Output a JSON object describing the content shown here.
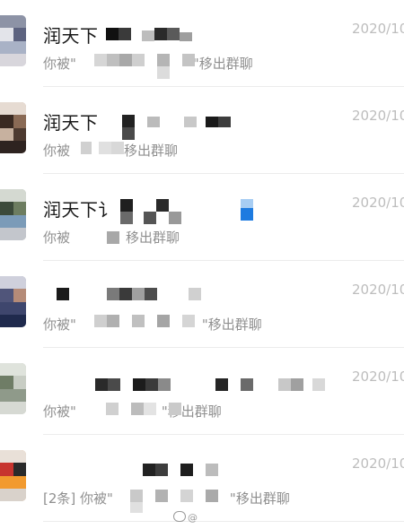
{
  "chats": [
    {
      "title": "润天下",
      "preview_before": "你被\"",
      "preview_after": "\"移出群聊",
      "time": "2020/10"
    },
    {
      "title": "润天下",
      "preview_before": "你被",
      "preview_after": "移出群聊",
      "time": "2020/10"
    },
    {
      "title": "润天下讠",
      "preview_before": "你被",
      "preview_after": "移出群聊",
      "time": "2020/10"
    },
    {
      "title": "",
      "preview_before": "你被\"",
      "preview_after": "\"移出群聊",
      "time": "2020/10"
    },
    {
      "title": "",
      "preview_before": "你被\"",
      "preview_after": "\"移出群聊",
      "time": "2020/10"
    },
    {
      "title": "",
      "preview_before": "[2条] 你被\"",
      "preview_after": "\"移出群聊",
      "time": "2020/10"
    }
  ],
  "watermark": "@"
}
